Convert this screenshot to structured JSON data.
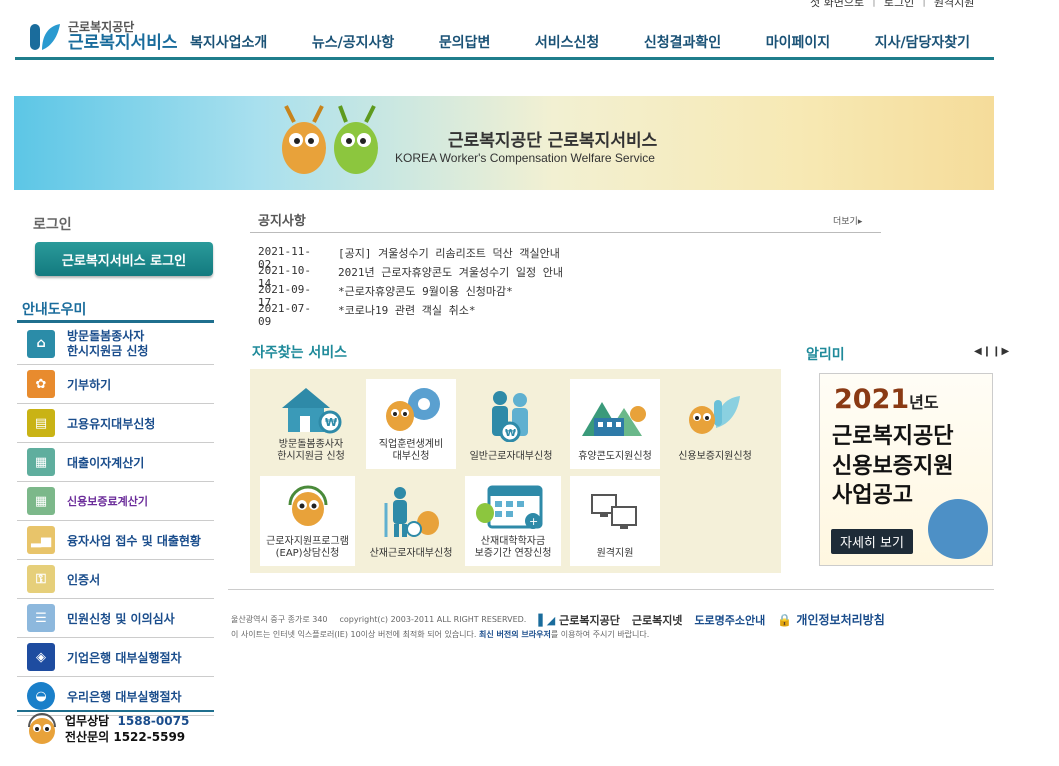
{
  "util": {
    "links": [
      "첫 화면으로",
      "로그인",
      "원격지원"
    ]
  },
  "logo": {
    "line1": "근로복지공단",
    "line2": "근로복지서비스"
  },
  "gnb": [
    "복지사업소개",
    "뉴스/공지사항",
    "문의답변",
    "서비스신청",
    "신청결과확인",
    "마이페이지",
    "지사/담당자찾기"
  ],
  "banner": {
    "title": "근로복지공단 근로복지서비스",
    "subtitle": "KOREA Worker's Compensation Welfare Service"
  },
  "login": {
    "title": "로그인",
    "button": "근로복지서비스 로그인"
  },
  "guide": {
    "title": "안내도우미",
    "items": [
      {
        "label1": "방문돌봄종사자",
        "label2": "한시지원금 신청",
        "icon": "house-icon",
        "color": "#2b8ca8"
      },
      {
        "label": "기부하기",
        "icon": "gift-icon",
        "color": "#e88b2e"
      },
      {
        "label": "고용유지대부신청",
        "icon": "document-icon",
        "color": "#c9b315"
      },
      {
        "label": "대출이자계산기",
        "icon": "calculator-icon",
        "color": "#5fae9e"
      },
      {
        "label": "신용보증료계산기",
        "icon": "calculator-icon",
        "color": "#7cb88a"
      },
      {
        "label": "융자사업 접수 및 대출현황",
        "icon": "chart-icon",
        "color": "#e8c46a"
      },
      {
        "label": "인증서",
        "icon": "key-icon",
        "color": "#e6cf7a"
      },
      {
        "label": "민원신청 및 이의심사",
        "icon": "clipboard-icon",
        "color": "#8db8dd"
      },
      {
        "label": "기업은행 대부실행절차",
        "icon": "ibk-logo-icon",
        "color": "#1e4ca0"
      },
      {
        "label": "우리은행 대부실행절차",
        "icon": "woori-logo-icon",
        "color": "#1a7fc9"
      }
    ]
  },
  "contact": {
    "label1": "업무상담",
    "num1": "1588-0075",
    "label2": "전산문의",
    "num2": "1522-5599"
  },
  "notice": {
    "title": "공지사항",
    "more": "더보기",
    "items": [
      {
        "date": "2021-11-02",
        "text": "[공지] 겨울성수기 리솜리조트 덕산 객실안내"
      },
      {
        "date": "2021-10-14",
        "text": "2021년 근로자휴양콘도 겨울성수기 일정 안내"
      },
      {
        "date": "2021-09-17",
        "text": "*근로자휴양콘도 9월이용 신청마감*"
      },
      {
        "date": "2021-07-09",
        "text": "*코로나19 관련 객실 취소*"
      }
    ]
  },
  "services": {
    "title": "자주찾는 서비스",
    "items": [
      {
        "l1": "방문돌봄종사자",
        "l2": "한시지원금 신청",
        "icon": "house-coin-icon"
      },
      {
        "l1": "직업훈련생계비",
        "l2": "대부신청",
        "icon": "mascot-gear-icon"
      },
      {
        "l1": "일반근로자대부신청",
        "l2": "",
        "icon": "people-coin-icon"
      },
      {
        "l1": "휴양콘도지원신청",
        "l2": "",
        "icon": "condo-icon"
      },
      {
        "l1": "신용보증지원신청",
        "l2": "",
        "icon": "mascot-logo-icon"
      },
      {
        "l1": "근로자지원프로그램",
        "l2": "(EAP)상담신청",
        "icon": "mascot-headset-icon"
      },
      {
        "l1": "산재근로자대부신청",
        "l2": "",
        "icon": "crutch-icon"
      },
      {
        "l1": "산재대학학자금",
        "l2": "보증기간 연장신청",
        "icon": "calendar-icon"
      },
      {
        "l1": "원격지원",
        "l2": "",
        "icon": "monitor-icon"
      }
    ]
  },
  "alimi": {
    "title": "알리미",
    "year": "2021",
    "year_suffix": "년도",
    "line1": "근로복지공단",
    "line2": "신용보증지원",
    "line3": "사업공고",
    "button": "자세히 보기"
  },
  "footer": {
    "address": "울산광역시 중구 종가로 340",
    "copyright": "copyright(c) 2003-2011 ALL RIGHT RESERVED.",
    "org": "근로복지공단",
    "net": "근로복지넷",
    "road": "도로명주소안내",
    "privacy": "개인정보처리방침",
    "note_pre": "이 사이트는 인터넷 익스플로러(IE) 10이상 버전에 최적화 되어 있습니다.",
    "note_link": "최신 버전의 브라우저",
    "note_post": "를 이용하여 주시기 바랍니다."
  }
}
